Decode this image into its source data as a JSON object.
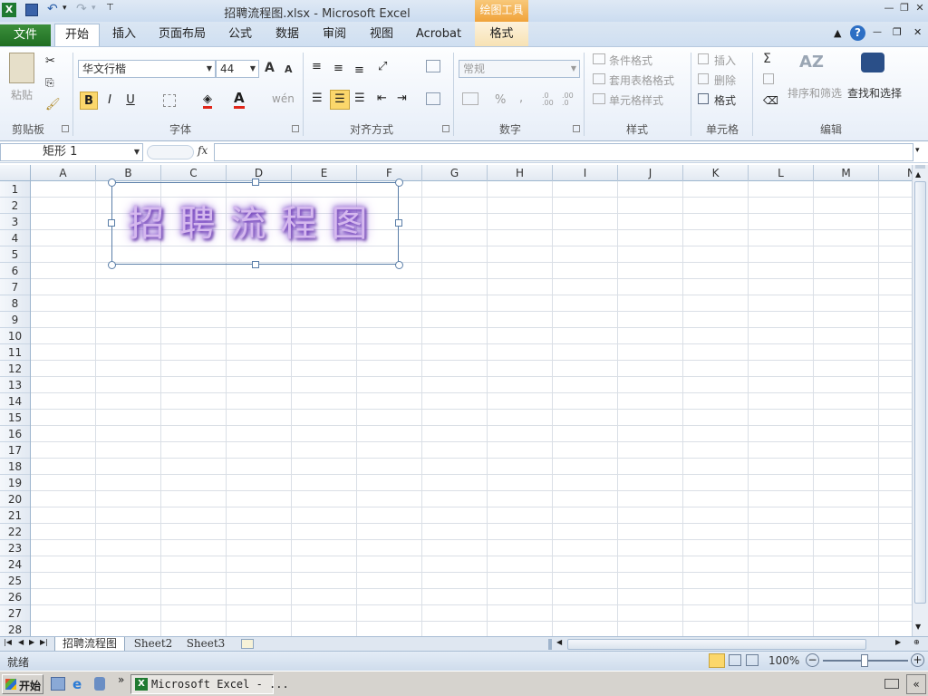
{
  "titlebar": {
    "filename": "招聘流程图.xlsx",
    "separator": " - ",
    "app": "Microsoft Excel",
    "context_header": "绘图工具"
  },
  "tabs": {
    "file": "文件",
    "home": "开始",
    "insert": "插入",
    "page_layout": "页面布局",
    "formulas": "公式",
    "data": "数据",
    "review": "审阅",
    "view": "视图",
    "acrobat": "Acrobat",
    "format": "格式"
  },
  "ribbon": {
    "clipboard": {
      "paste": "粘贴",
      "label": "剪贴板"
    },
    "font": {
      "name": "华文行楷",
      "size": "44",
      "bold": "B",
      "italic": "I",
      "underline": "U",
      "grow": "A",
      "shrink": "A",
      "label": "字体"
    },
    "alignment": {
      "label": "对齐方式"
    },
    "number": {
      "format": "常规",
      "percent": "%",
      "comma": ",",
      "inc": ".0 .00",
      "dec": ".00 .0",
      "label": "数字"
    },
    "styles": {
      "conditional": "条件格式",
      "table": "套用表格格式",
      "cell": "单元格样式",
      "label": "样式"
    },
    "cells": {
      "insert": "插入",
      "delete": "删除",
      "format": "格式",
      "label": "单元格"
    },
    "editing": {
      "sum": "Σ",
      "sort": "排序和筛选",
      "find": "查找和选择",
      "label": "编辑"
    }
  },
  "formula_bar": {
    "name_box": "矩形 1",
    "fx": "fx",
    "value": ""
  },
  "columns": [
    "A",
    "B",
    "C",
    "D",
    "E",
    "F",
    "G",
    "H",
    "I",
    "J",
    "K",
    "L",
    "M",
    "N"
  ],
  "rows": [
    "1",
    "2",
    "3",
    "4",
    "5",
    "6",
    "7",
    "8",
    "9",
    "10",
    "11",
    "12",
    "13",
    "14",
    "15",
    "16",
    "17",
    "18",
    "19",
    "20",
    "21",
    "22",
    "23",
    "24",
    "25",
    "26",
    "27",
    "28"
  ],
  "shape": {
    "text": "招聘流程图",
    "glow_color": "#7b4cc8"
  },
  "sheets": [
    "招聘流程图",
    "Sheet2",
    "Sheet3"
  ],
  "status": {
    "ready": "就绪",
    "zoom": "100%"
  },
  "taskbar": {
    "start": "开始",
    "window": "Microsoft Excel - ..."
  },
  "colors": {
    "file_tab": "#2a7a2d",
    "context": "#f0a33a",
    "ribbon_bg": "#e7eef8"
  }
}
